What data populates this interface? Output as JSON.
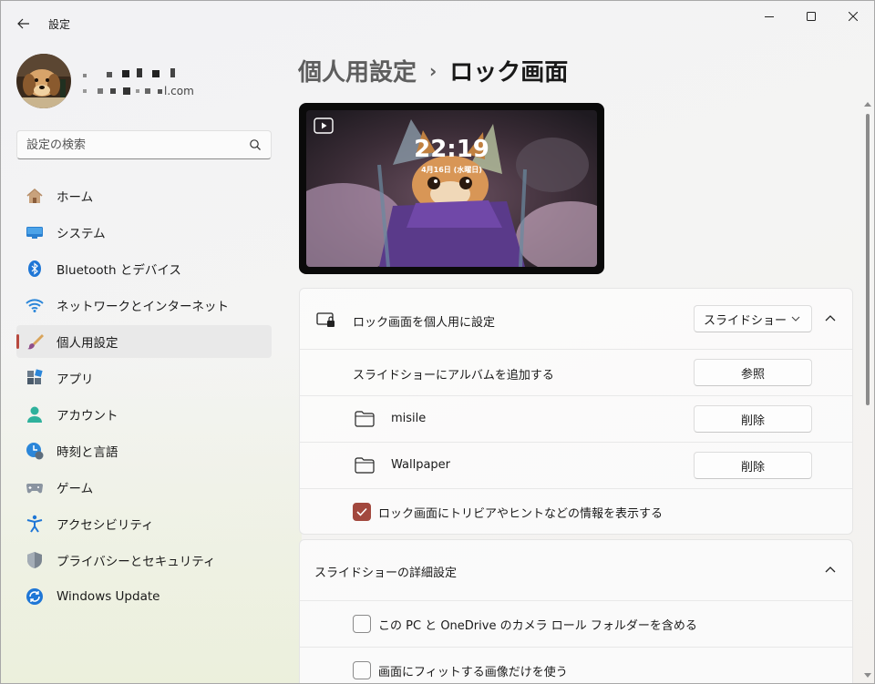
{
  "app": {
    "title": "設定"
  },
  "user": {
    "email_suffix": "l.com"
  },
  "search": {
    "placeholder": "設定の検索"
  },
  "nav": [
    {
      "label": "ホーム",
      "icon": "home-icon"
    },
    {
      "label": "システム",
      "icon": "system-icon"
    },
    {
      "label": "Bluetooth とデバイス",
      "icon": "bluetooth-icon"
    },
    {
      "label": "ネットワークとインターネット",
      "icon": "network-icon"
    },
    {
      "label": "個人用設定",
      "icon": "brush-icon",
      "active": true
    },
    {
      "label": "アプリ",
      "icon": "apps-icon"
    },
    {
      "label": "アカウント",
      "icon": "account-icon"
    },
    {
      "label": "時刻と言語",
      "icon": "time-language-icon"
    },
    {
      "label": "ゲーム",
      "icon": "gamepad-icon"
    },
    {
      "label": "アクセシビリティ",
      "icon": "accessibility-icon"
    },
    {
      "label": "プライバシーとセキュリティ",
      "icon": "shield-icon"
    },
    {
      "label": "Windows Update",
      "icon": "update-icon"
    }
  ],
  "breadcrumb": {
    "parent": "個人用設定",
    "separator": "›",
    "current": "ロック画面"
  },
  "preview": {
    "time": "22:19",
    "date": "4月16日 (水曜日)"
  },
  "lock_card": {
    "title": "ロック画面を個人用に設定",
    "mode_value": "スライドショー",
    "add_album_label": "スライドショーにアルバムを追加する",
    "browse_label": "参照",
    "albums": [
      {
        "name": "misile",
        "remove_label": "削除"
      },
      {
        "name": "Wallpaper",
        "remove_label": "削除"
      }
    ],
    "trivia_label": "ロック画面にトリビアやヒントなどの情報を表示する",
    "trivia_checked": true
  },
  "slideshow_card": {
    "title": "スライドショーの詳細設定",
    "options": [
      {
        "label": "この PC と OneDrive のカメラ ロール フォルダーを含める",
        "checked": false
      },
      {
        "label": "画面にフィットする画像だけを使う",
        "checked": false
      }
    ]
  },
  "colors": {
    "accent": "#a2483e",
    "active_indicator": "#b84a3f"
  }
}
